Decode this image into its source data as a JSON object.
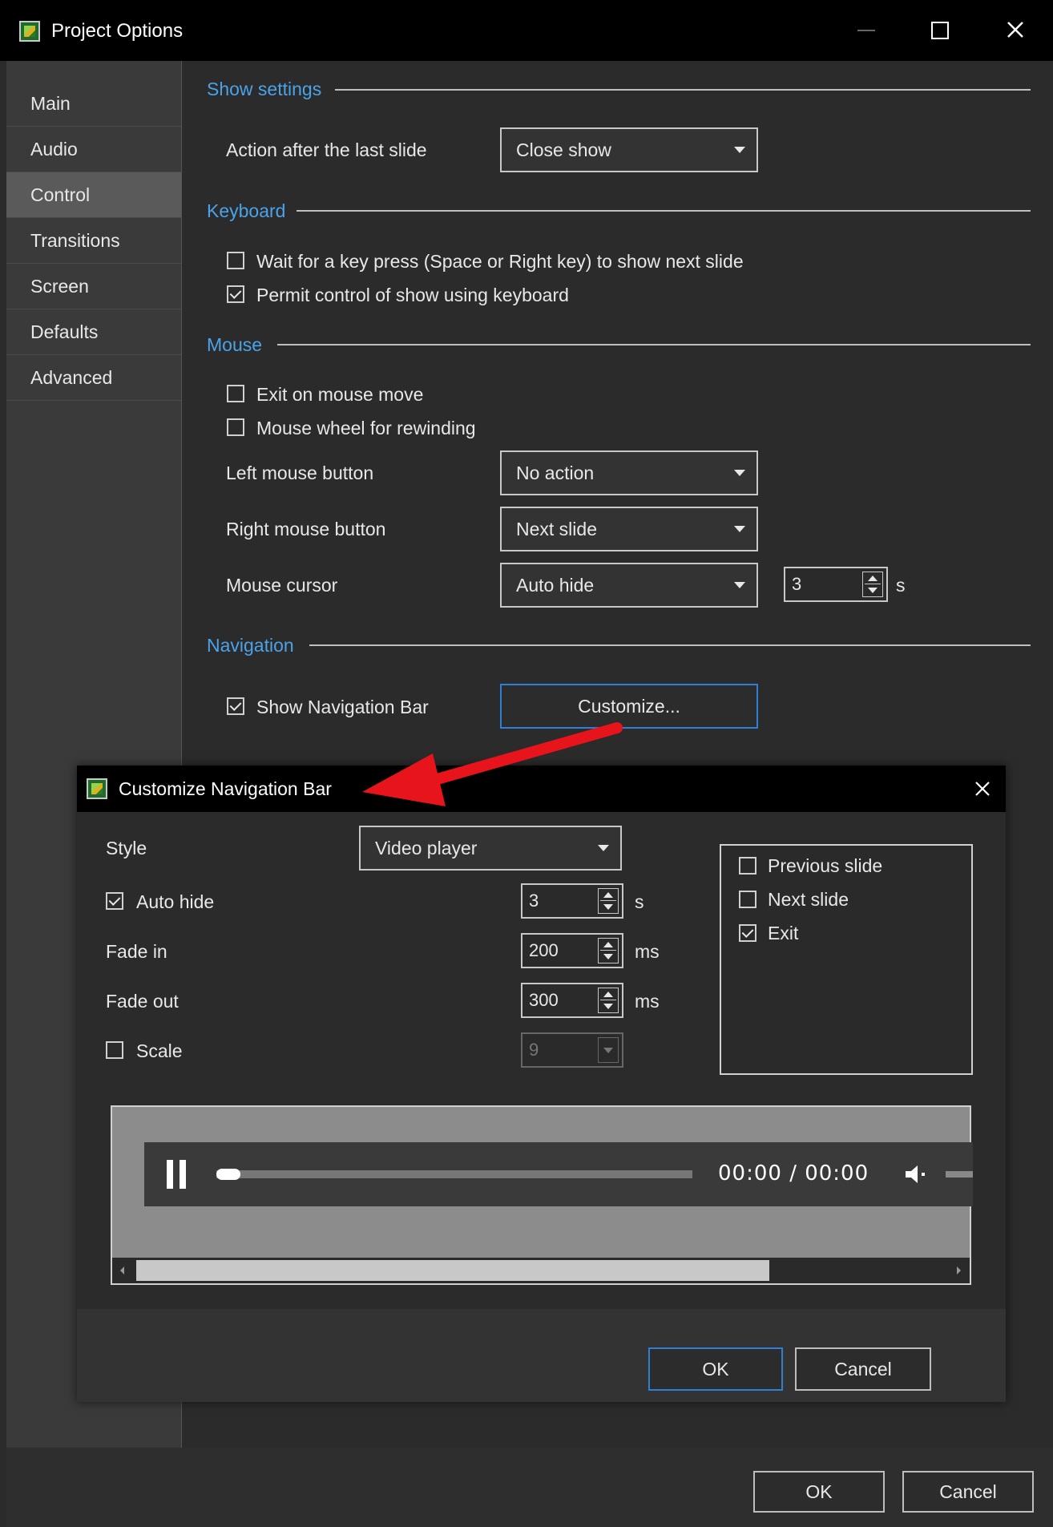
{
  "main_window": {
    "title": "Project Options",
    "sidebar": {
      "items": [
        {
          "label": "Main",
          "active": false
        },
        {
          "label": "Audio",
          "active": false
        },
        {
          "label": "Control",
          "active": true
        },
        {
          "label": "Transitions",
          "active": false
        },
        {
          "label": "Screen",
          "active": false
        },
        {
          "label": "Defaults",
          "active": false
        },
        {
          "label": "Advanced",
          "active": false
        }
      ]
    },
    "show_settings": {
      "section": "Show settings",
      "action_after_last_slide_label": "Action after the last slide",
      "action_after_last_slide_value": "Close show"
    },
    "keyboard": {
      "section": "Keyboard",
      "wait_key_label": "Wait for a key press (Space or Right key) to show next slide",
      "wait_key_checked": false,
      "permit_keyboard_label": "Permit control of show using keyboard",
      "permit_keyboard_checked": true
    },
    "mouse": {
      "section": "Mouse",
      "exit_on_move_label": "Exit on mouse move",
      "exit_on_move_checked": false,
      "wheel_rewind_label": "Mouse wheel for rewinding",
      "wheel_rewind_checked": false,
      "left_button_label": "Left mouse button",
      "left_button_value": "No action",
      "right_button_label": "Right mouse button",
      "right_button_value": "Next slide",
      "cursor_label": "Mouse cursor",
      "cursor_value": "Auto hide",
      "cursor_seconds": "3",
      "cursor_unit": "s"
    },
    "navigation": {
      "section": "Navigation",
      "show_nav_bar_label": "Show Navigation Bar",
      "show_nav_bar_checked": true,
      "customize_label": "Customize..."
    },
    "footer": {
      "ok_label": "OK",
      "cancel_label": "Cancel"
    }
  },
  "dialog": {
    "title": "Customize Navigation Bar",
    "style_label": "Style",
    "style_value": "Video player",
    "auto_hide_label": "Auto hide",
    "auto_hide_checked": true,
    "auto_hide_value": "3",
    "auto_hide_unit": "s",
    "fade_in_label": "Fade in",
    "fade_in_value": "200",
    "fade_in_unit": "ms",
    "fade_out_label": "Fade out",
    "fade_out_value": "300",
    "fade_out_unit": "ms",
    "scale_label": "Scale",
    "scale_checked": false,
    "scale_value": "9",
    "buttons_list": [
      {
        "label": "Previous slide",
        "checked": false
      },
      {
        "label": "Next slide",
        "checked": false
      },
      {
        "label": "Exit",
        "checked": true
      }
    ],
    "preview": {
      "time_text": "00:00 / 00:00",
      "progress": 0.05
    },
    "ok_label": "OK",
    "cancel_label": "Cancel"
  },
  "colors": {
    "accent": "#4aa3e8",
    "focus_border": "#2f7fd6",
    "arrow": "#e8141c"
  },
  "icons": [
    "app-icon",
    "minimize-icon",
    "maximize-icon",
    "close-icon",
    "chevron-down-icon",
    "pause-icon",
    "volume-icon",
    "red-pointer-arrow"
  ]
}
